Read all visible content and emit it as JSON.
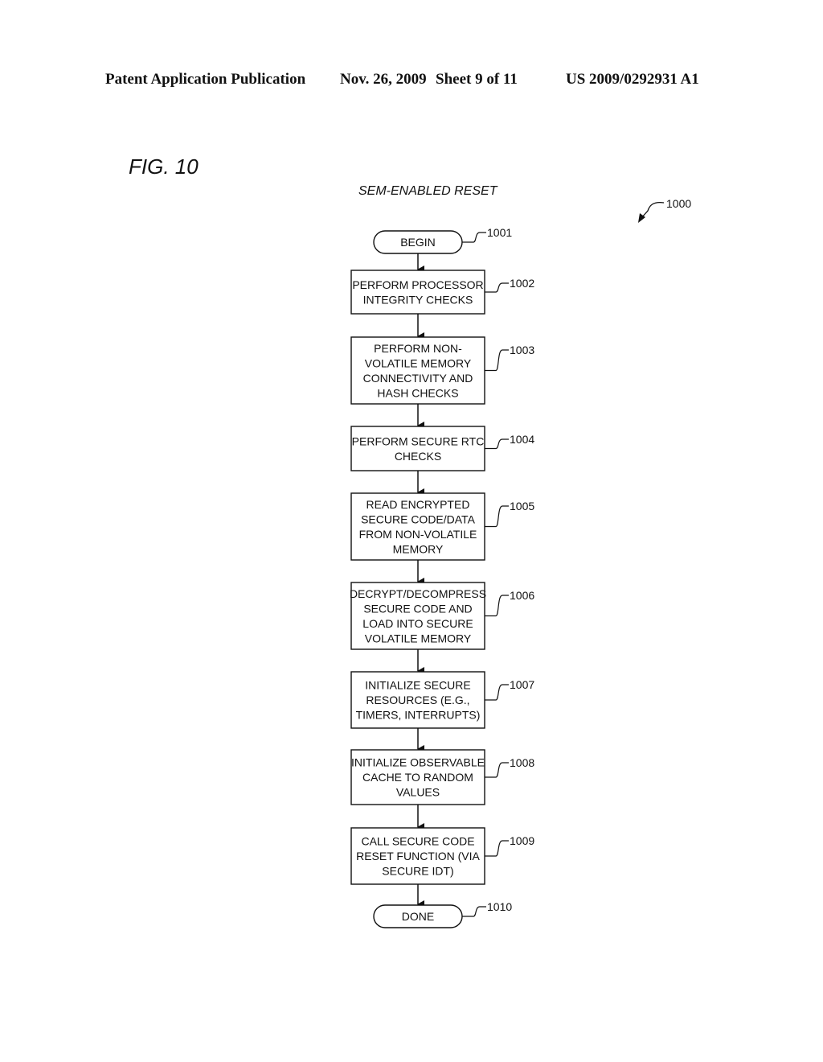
{
  "header": {
    "publication": "Patent Application Publication",
    "date": "Nov. 26, 2009",
    "sheet": "Sheet 9 of 11",
    "number": "US 2009/0292931 A1"
  },
  "figure": {
    "label": "FIG. 10",
    "title": "SEM-ENABLED RESET",
    "ref": "1000"
  },
  "flow": [
    {
      "id": "1001",
      "type": "terminal",
      "lines": [
        "BEGIN"
      ]
    },
    {
      "id": "1002",
      "type": "process",
      "lines": [
        "PERFORM PROCESSOR",
        "INTEGRITY CHECKS"
      ]
    },
    {
      "id": "1003",
      "type": "process",
      "lines": [
        "PERFORM NON-",
        "VOLATILE MEMORY",
        "CONNECTIVITY AND",
        "HASH CHECKS"
      ]
    },
    {
      "id": "1004",
      "type": "process",
      "lines": [
        "PERFORM SECURE RTC",
        "CHECKS"
      ]
    },
    {
      "id": "1005",
      "type": "process",
      "lines": [
        "READ ENCRYPTED",
        "SECURE CODE/DATA",
        "FROM NON-VOLATILE",
        "MEMORY"
      ]
    },
    {
      "id": "1006",
      "type": "process",
      "lines": [
        "DECRYPT/DECOMPRESS",
        "SECURE CODE AND",
        "LOAD INTO SECURE",
        "VOLATILE MEMORY"
      ]
    },
    {
      "id": "1007",
      "type": "process",
      "lines": [
        "INITIALIZE SECURE",
        "RESOURCES (E.G.,",
        "TIMERS, INTERRUPTS)"
      ]
    },
    {
      "id": "1008",
      "type": "process",
      "lines": [
        "INITIALIZE OBSERVABLE",
        "CACHE TO RANDOM",
        "VALUES"
      ]
    },
    {
      "id": "1009",
      "type": "process",
      "lines": [
        "CALL SECURE CODE",
        "RESET FUNCTION (VIA",
        "SECURE IDT)"
      ]
    },
    {
      "id": "1010",
      "type": "terminal",
      "lines": [
        "DONE"
      ]
    }
  ]
}
